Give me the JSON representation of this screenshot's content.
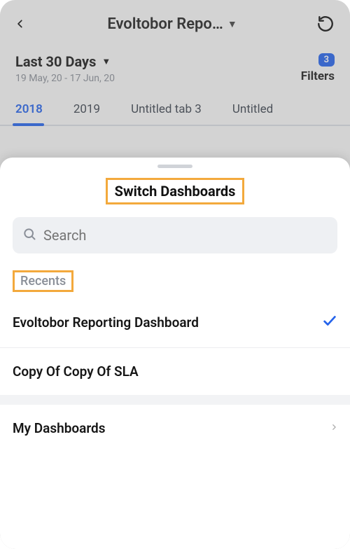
{
  "header": {
    "title": "Evoltobor Repo…"
  },
  "range": {
    "label": "Last 30 Days",
    "dates": "19 May, 20 - 17 Jun, 20"
  },
  "filters": {
    "count": "3",
    "label": "Filters"
  },
  "tabs": [
    {
      "label": "2018",
      "active": true
    },
    {
      "label": "2019",
      "active": false
    },
    {
      "label": "Untitled tab 3",
      "active": false
    },
    {
      "label": "Untitled",
      "active": false
    }
  ],
  "sheet": {
    "title": "Switch Dashboards",
    "search_placeholder": "Search",
    "recents_label": "Recents",
    "recents": [
      {
        "label": "Evoltobor Reporting Dashboard",
        "selected": true
      },
      {
        "label": "Copy Of Copy Of SLA",
        "selected": false
      }
    ],
    "my_dashboards_label": "My Dashboards"
  }
}
